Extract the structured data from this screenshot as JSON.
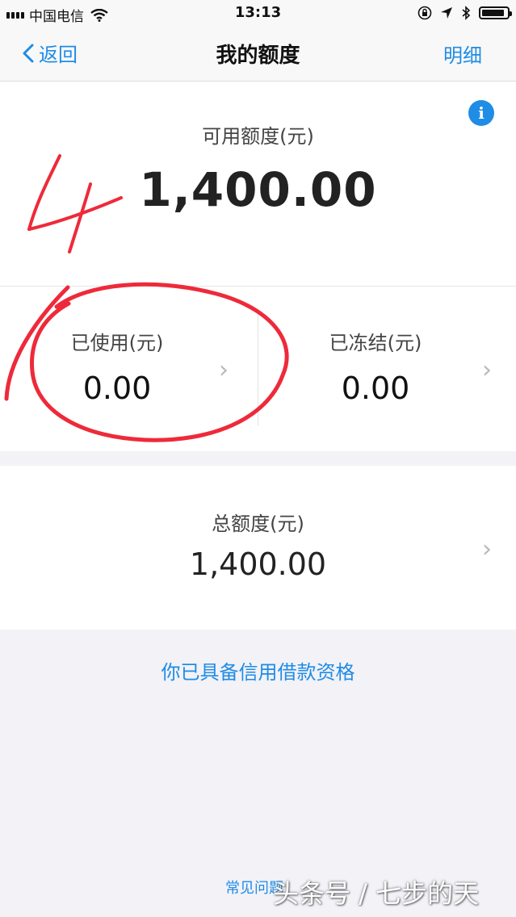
{
  "status_bar": {
    "carrier": "中国电信",
    "time": "13:13",
    "battery_level": 0.9
  },
  "nav": {
    "back_label": "返回",
    "title": "我的额度",
    "detail_label": "明细"
  },
  "available": {
    "label": "可用额度(元)",
    "amount": "1,400.00",
    "info_icon_glyph": "i"
  },
  "used": {
    "label": "已使用(元)",
    "amount": "0.00"
  },
  "frozen": {
    "label": "已冻结(元)",
    "amount": "0.00"
  },
  "total": {
    "label": "总额度(元)",
    "amount": "1,400.00"
  },
  "eligibility_text": "你已具备信用借款资格",
  "footer": {
    "faq_label": "常见问题",
    "watermark": "头条号 / 七步的天"
  },
  "chevron_glyph": "›",
  "colors": {
    "accent": "#1f8ce6",
    "annotation": "#ee2a3a",
    "background": "#f2f2f7"
  }
}
